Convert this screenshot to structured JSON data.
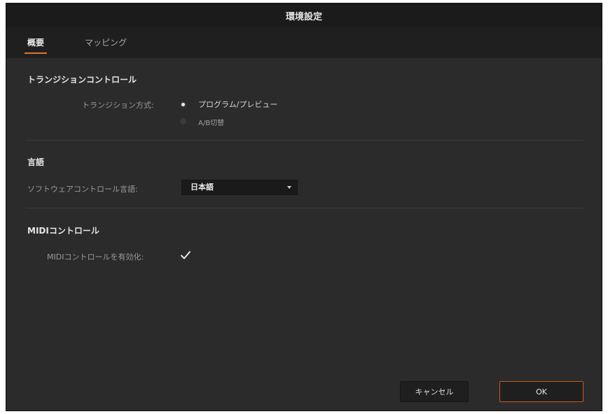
{
  "window": {
    "title": "環境設定"
  },
  "tabs": [
    {
      "label": "概要",
      "active": true
    },
    {
      "label": "マッピング",
      "active": false
    }
  ],
  "transition": {
    "section_title": "トランジションコントロール",
    "method_label": "トランジション方式:",
    "options": [
      {
        "label": "プログラム/プレビュー",
        "selected": true
      },
      {
        "label": "A/B切替",
        "selected": false
      }
    ]
  },
  "language": {
    "section_title": "言語",
    "field_label": "ソフトウェアコントロール言語:",
    "selected": "日本語"
  },
  "midi": {
    "section_title": "MIDIコントロール",
    "enable_label": "MIDIコントロールを有効化:",
    "enabled": true
  },
  "buttons": {
    "cancel": "キャンセル",
    "ok": "OK"
  },
  "colors": {
    "accent": "#e0752d",
    "background": "#2b2b2b",
    "titlebar": "#1b1b1b"
  }
}
